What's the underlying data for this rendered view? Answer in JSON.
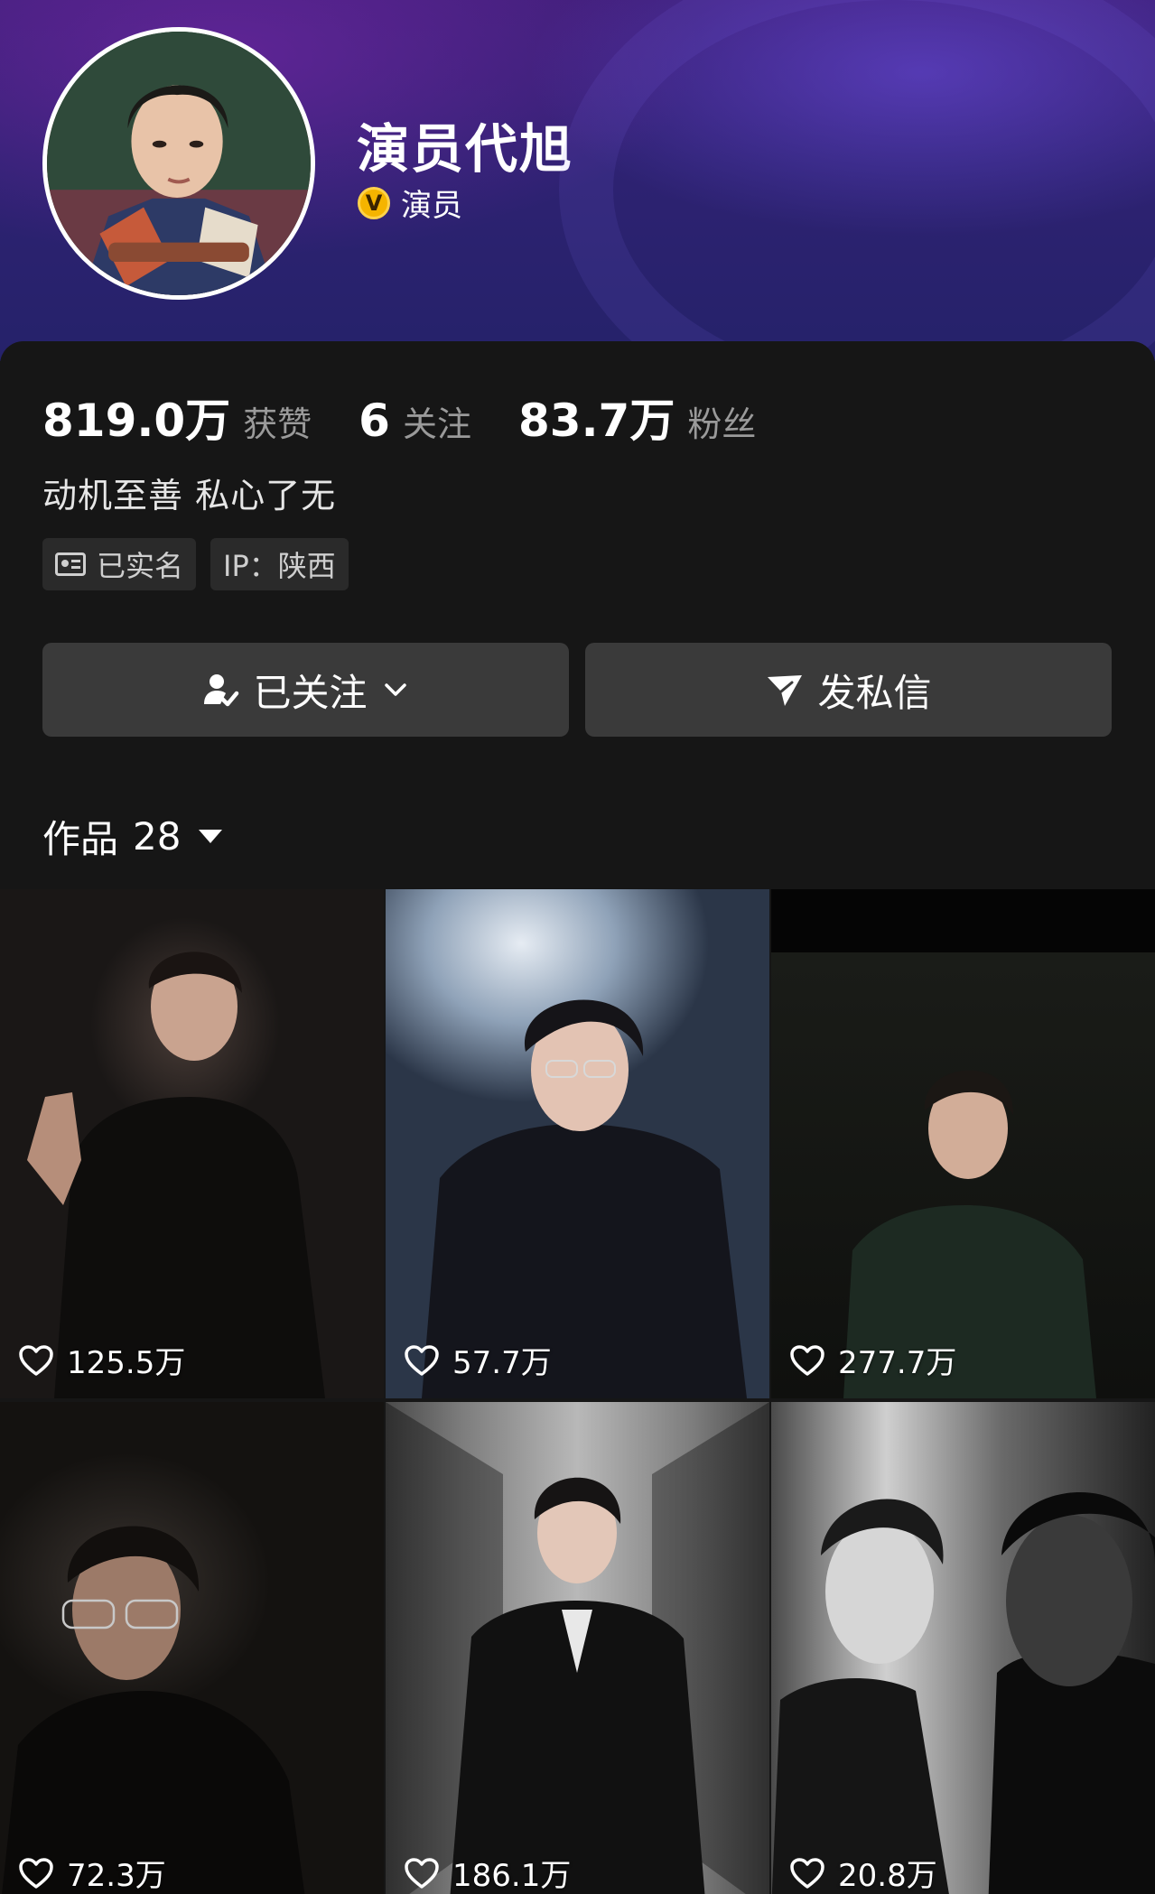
{
  "profile": {
    "name": "演员代旭",
    "verify_label": "演员",
    "verify_icon": "verified-v-icon",
    "accent": "#f5b400"
  },
  "stats": [
    {
      "value": "819.0万",
      "label": "获赞"
    },
    {
      "value": "6",
      "label": "关注"
    },
    {
      "value": "83.7万",
      "label": "粉丝"
    }
  ],
  "bio": "动机至善 私心了无",
  "tags": {
    "verified": "已实名",
    "ip": "IP：陕西"
  },
  "actions": {
    "follow_label": "已关注",
    "message_label": "发私信"
  },
  "works": {
    "label": "作品",
    "count": "28"
  },
  "videos": [
    {
      "likes": "125.5万"
    },
    {
      "likes": "57.7万"
    },
    {
      "likes": "277.7万"
    },
    {
      "likes": "72.3万"
    },
    {
      "likes": "186.1万"
    },
    {
      "likes": "20.8万"
    }
  ]
}
